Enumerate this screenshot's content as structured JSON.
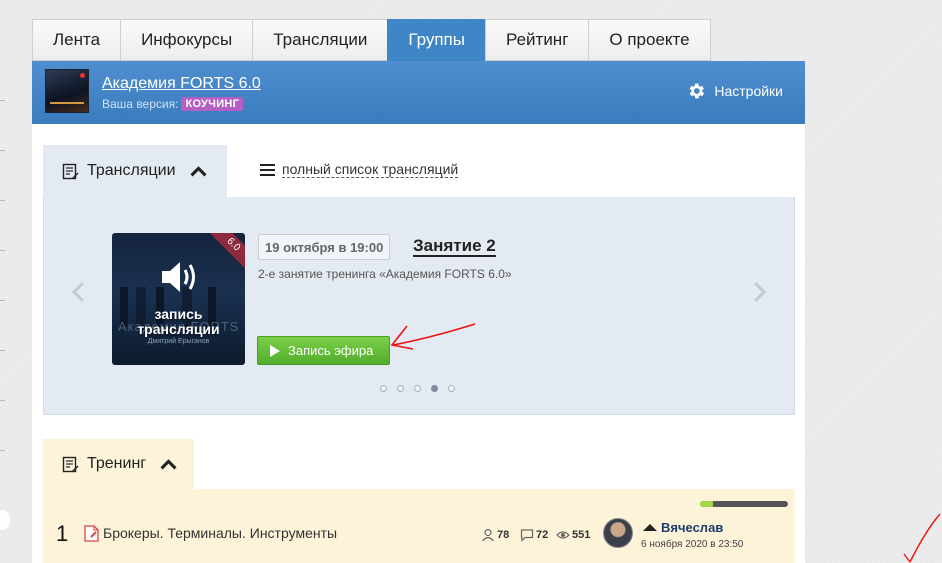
{
  "nav": {
    "tabs": [
      {
        "label": "Лента"
      },
      {
        "label": "Инфокурсы"
      },
      {
        "label": "Трансляции"
      },
      {
        "label": "Группы"
      },
      {
        "label": "Рейтинг"
      },
      {
        "label": "О проекте"
      }
    ],
    "active": "Группы"
  },
  "group": {
    "title": "Академия FORTS 6.0",
    "version_label": "Ваша версия:",
    "version_badge": "КОУЧИНГ",
    "settings_label": "Настройки"
  },
  "broadcasts": {
    "tab_label": "Трансляции",
    "full_list_label": "полный список трансляций",
    "item": {
      "thumb_badge": "6.0",
      "thumb_caption_line1": "запись",
      "thumb_caption_line2": "трансляции",
      "thumb_watermark": "Академия FORTS",
      "thumb_author": "Дмитрий Ерыганов",
      "date": "19 октября в 19:00",
      "title": "Занятие 2",
      "description": "2-е занятие тренинга «Академия FORTS 6.0»",
      "button_label": "Запись эфира"
    },
    "pagination": {
      "count": 5,
      "active_index": 3
    }
  },
  "training": {
    "tab_label": "Тренинг",
    "progress": 0.15,
    "rows": [
      {
        "num": "1",
        "title": "Брокеры. Терминалы. Инструменты",
        "members": "78",
        "comments": "72",
        "views": "551",
        "author": "Вячеслав",
        "date": "6 ноября 2020 в 23:50"
      }
    ]
  },
  "colors": {
    "accent_blue": "#3f86c7",
    "badge_purple": "#b45fc4",
    "button_green": "#5fb832",
    "broadcast_bg": "#e4eaf2",
    "training_bg": "#fdf3d9"
  }
}
